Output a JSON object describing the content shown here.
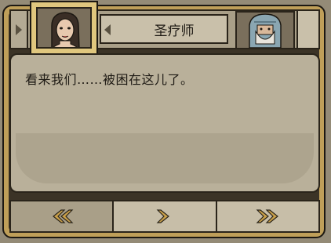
{
  "header": {
    "speaker_name": "圣疗师"
  },
  "dialog": {
    "line": "看来我们……被困在这儿了。"
  },
  "colors": {
    "frame_gold": "#bf9f59",
    "panel": "#b9b09a",
    "arrow_gold": "#c9a04a"
  },
  "icons": {
    "nav_left": "triangle-right-icon",
    "nameplate": "triangle-left-icon",
    "btn_back": "double-chevron-left-icon",
    "btn_next": "chevron-right-icon",
    "btn_skip": "double-chevron-right-icon"
  }
}
